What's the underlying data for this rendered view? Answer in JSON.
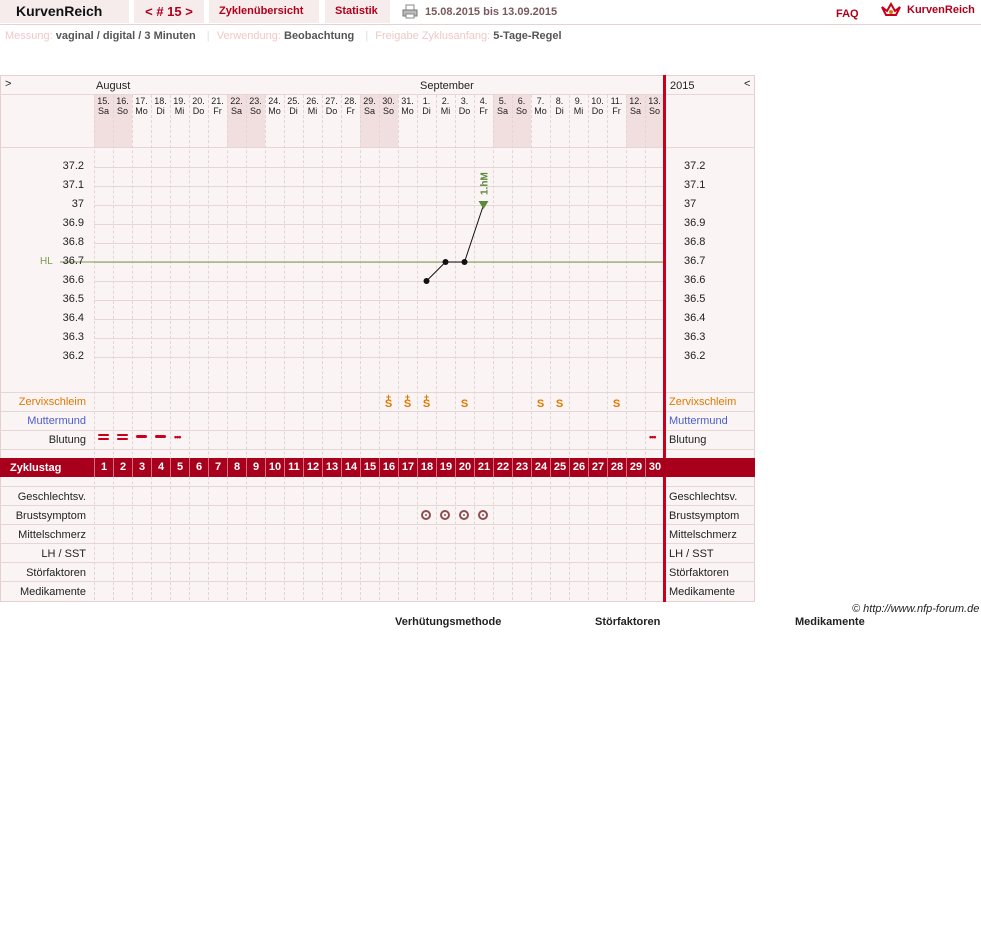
{
  "app": {
    "title": "KurvenReich",
    "cycle_nav": "< # 15 >",
    "tab_overview": "Zyklenübersicht",
    "tab_stats": "Statistik",
    "date_range": "15.08.2015 bis 13.09.2015",
    "faq": "FAQ",
    "logo_text": "KurvenReich"
  },
  "info": {
    "messung_label": "Messung:",
    "messung_value": "vaginal / digital / 3 Minuten",
    "verwendung_label": "Verwendung:",
    "verwendung_value": "Beobachtung",
    "freigabe_label": "Freigabe Zyklusanfang:",
    "freigabe_value": "5-Tage-Regel"
  },
  "chart": {
    "nav_prev": ">",
    "nav_next": "<",
    "year": "2015",
    "months": [
      "August",
      "September"
    ],
    "days": [
      [
        "15.",
        "Sa"
      ],
      [
        "16.",
        "So"
      ],
      [
        "17.",
        "Mo"
      ],
      [
        "18.",
        "Di"
      ],
      [
        "19.",
        "Mi"
      ],
      [
        "20.",
        "Do"
      ],
      [
        "21.",
        "Fr"
      ],
      [
        "22.",
        "Sa"
      ],
      [
        "23.",
        "So"
      ],
      [
        "24.",
        "Mo"
      ],
      [
        "25.",
        "Di"
      ],
      [
        "26.",
        "Mi"
      ],
      [
        "27.",
        "Do"
      ],
      [
        "28.",
        "Fr"
      ],
      [
        "29.",
        "Sa"
      ],
      [
        "30.",
        "So"
      ],
      [
        "31.",
        "Mo"
      ],
      [
        "1.",
        "Di"
      ],
      [
        "2.",
        "Mi"
      ],
      [
        "3.",
        "Do"
      ],
      [
        "4.",
        "Fr"
      ],
      [
        "5.",
        "Sa"
      ],
      [
        "6.",
        "So"
      ],
      [
        "7.",
        "Mo"
      ],
      [
        "8.",
        "Di"
      ],
      [
        "9.",
        "Mi"
      ],
      [
        "10.",
        "Do"
      ],
      [
        "11.",
        "Fr"
      ],
      [
        "12.",
        "Sa"
      ],
      [
        "13.",
        "So"
      ]
    ],
    "weekend_idx": [
      0,
      1,
      7,
      8,
      14,
      15,
      21,
      22,
      28,
      29
    ],
    "y_ticks": [
      "37.2",
      "37.1",
      "37",
      "36.9",
      "36.8",
      "36.7",
      "36.6",
      "36.5",
      "36.4",
      "36.3",
      "36.2"
    ],
    "hl_label": "HL",
    "hl_value": 36.7,
    "temperatures": [
      {
        "day": 18,
        "t": 36.6
      },
      {
        "day": 19,
        "t": 36.7
      },
      {
        "day": 20,
        "t": 36.7
      },
      {
        "day": 21,
        "t": 37.0
      }
    ],
    "marker_text": "1.hM",
    "rows_top": [
      "Zervixschleim",
      "Muttermund",
      "Blutung"
    ],
    "zervix": [
      {
        "day": 16,
        "v": "S+"
      },
      {
        "day": 17,
        "v": "S+"
      },
      {
        "day": 18,
        "v": "S+"
      },
      {
        "day": 20,
        "v": "S"
      },
      {
        "day": 24,
        "v": "S"
      },
      {
        "day": 25,
        "v": "S"
      },
      {
        "day": 28,
        "v": "S"
      }
    ],
    "blutung": [
      {
        "day": 1,
        "v": "stark"
      },
      {
        "day": 2,
        "v": "stark"
      },
      {
        "day": 3,
        "v": "mittel"
      },
      {
        "day": 4,
        "v": "mittel"
      },
      {
        "day": 5,
        "v": "schmier"
      },
      {
        "day": 30,
        "v": "schmier"
      }
    ],
    "cycle_label": "Zyklustag",
    "cycle_days": [
      "1",
      "2",
      "3",
      "4",
      "5",
      "6",
      "7",
      "8",
      "9",
      "10",
      "11",
      "12",
      "13",
      "14",
      "15",
      "16",
      "17",
      "18",
      "19",
      "20",
      "21",
      "22",
      "23",
      "24",
      "25",
      "26",
      "27",
      "28",
      "29",
      "30"
    ],
    "rows_bottom": [
      "Geschlechtsv.",
      "Brustsymptom",
      "Mittelschmerz",
      "LH / SST",
      "Störfaktoren",
      "Medikamente"
    ],
    "brust_days": [
      18,
      19,
      20,
      21
    ],
    "colors": {
      "accent": "#b1001c",
      "zervix": "#e07800",
      "muttermund": "#4a5ec8",
      "hl": "#7a9a4a",
      "marker": "#5a8a3a"
    }
  },
  "footer": {
    "copyright": "© http://www.nfp-forum.de",
    "col1": "Verhütungsmethode",
    "col2": "Störfaktoren",
    "col3": "Medikamente"
  }
}
